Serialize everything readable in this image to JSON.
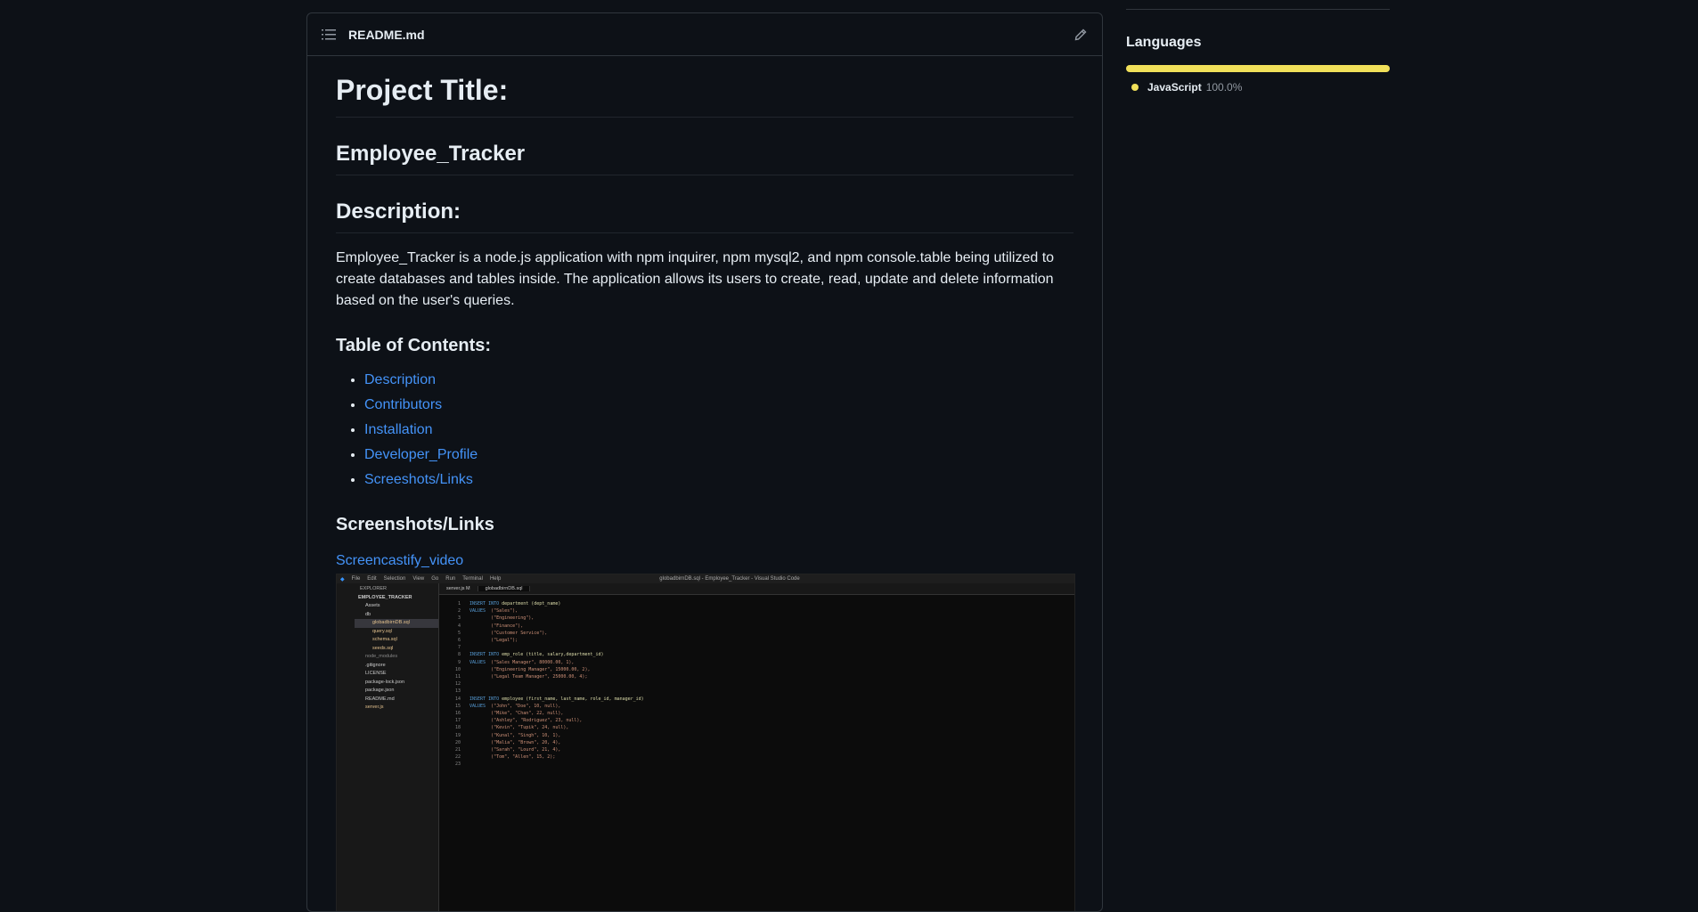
{
  "readme": {
    "filename": "README.md",
    "project_title_heading": "Project Title:",
    "project_name": "Employee_Tracker",
    "description_heading": "Description:",
    "description_text": "Employee_Tracker is a node.js application with npm inquirer, npm mysql2, and npm console.table being utilized to create databases and tables inside. The application allows its users to create, read, update and delete information based on the user's queries.",
    "toc_heading": "Table of Contents:",
    "toc_items": [
      "Description",
      "Contributors",
      "Installation",
      "Developer_Profile",
      "Screeshots/Links"
    ],
    "screenshots_heading": "Screenshots/Links",
    "video_link": "Screencastify_video",
    "screenshot": {
      "menu": [
        "File",
        "Edit",
        "Selection",
        "View",
        "Go",
        "Run",
        "Terminal",
        "Help"
      ],
      "window_title": "globadbirnDB.sql - Employee_Tracker - Visual Studio Code",
      "explorer_title": "EXPLORER",
      "explorer_items": [
        "EMPLOYEE_TRACKER",
        "Assets",
        "db",
        "globadbirnDB.sql",
        "query.sql",
        "schema.sql",
        "seeds.sql",
        "node_modules",
        ".gitignore",
        "LICENSE",
        "package-lock.json",
        "package.json",
        "README.md",
        "server.js"
      ],
      "tabs": [
        "server.js M",
        "globadbirnDB.sql"
      ],
      "code_lines": [
        "INSERT INTO department (dept_name)",
        "VALUES  (\"Sales\"),",
        "        (\"Engineering\"),",
        "        (\"Finance\"),",
        "        (\"Customer Service\"),",
        "        (\"Legal\");",
        "",
        "INSERT INTO emp_role (title, salary,department_id)",
        "VALUES  (\"Sales Manager\", 80000.00, 1),",
        "        (\"Engineering Manager\", 15000.00, 2),",
        "        (\"Legal Team Manager\", 25000.00, 4);",
        "",
        "",
        "INSERT INTO employee (first_name, last_name, role_id, manager_id)",
        "VALUES  (\"John\", \"Doe\", 10, null),",
        "        (\"Mike\", \"Chan\", 22, null),",
        "        (\"Ashley\", \"Rodriguez\", 23, null),",
        "        (\"Kevin\", \"Tupik\", 24, null),",
        "        (\"Kunal\", \"Singh\", 10, 1),",
        "        (\"Malia\", \"Brown\", 20, 4),",
        "        (\"Sarah\", \"Lourd\", 21, 4),",
        "        (\"Tom\", \"Allen\", 15, 2);",
        ""
      ]
    }
  },
  "sidebar": {
    "languages_heading": "Languages",
    "languages": [
      {
        "name": "JavaScript",
        "percent": "100.0%",
        "color": "#f1e05a"
      }
    ]
  },
  "colors": {
    "background": "#0d1117",
    "link": "#4493f8",
    "border": "#30363d",
    "javascript": "#f1e05a"
  }
}
